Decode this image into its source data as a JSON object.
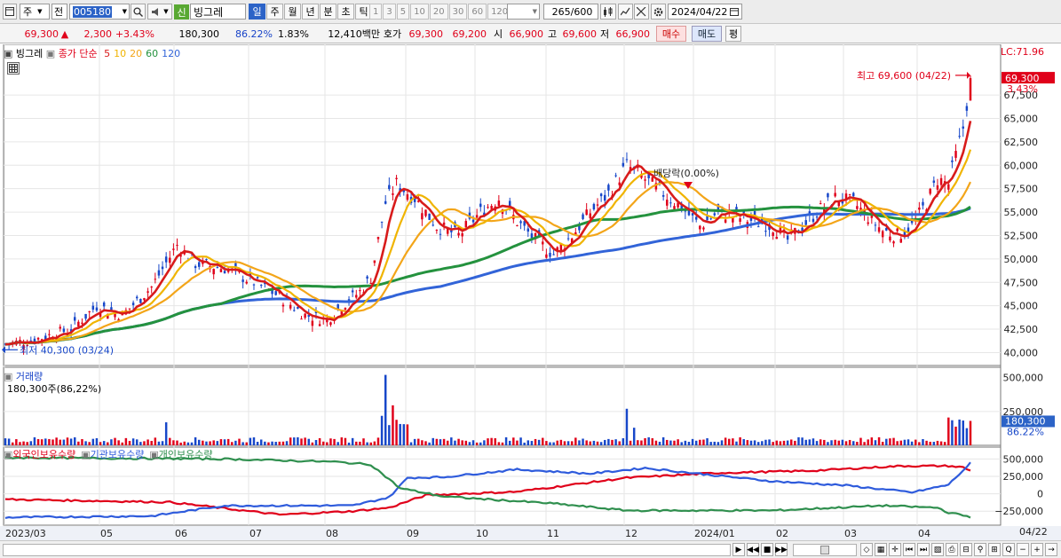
{
  "toolbar": {
    "market_type": "주",
    "market_all": "전",
    "stock_code": "005180",
    "badge_new": "신",
    "stock_name": "빙그레",
    "period_tabs": [
      "일",
      "주",
      "월",
      "년",
      "분",
      "초",
      "틱"
    ],
    "selected_period": "일",
    "interval_numbers": [
      "1",
      "3",
      "5",
      "10",
      "20",
      "30",
      "60",
      "120"
    ],
    "count": "265",
    "count_total": "/600",
    "date": "2024/04/22"
  },
  "quote": {
    "price": "69,300",
    "arrow": "▲",
    "change": "2,300",
    "change_pct": "+3.43%",
    "volume": "180,300",
    "volume_ratio": "86.22%",
    "turnover": "1.83%",
    "trade_value": "12,410백만",
    "hoga_label": "호가",
    "ask": "69,300",
    "bid": "69,200",
    "open_label": "시",
    "open": "66,900",
    "high_label": "고",
    "high": "69,600",
    "low_label": "저",
    "low": "66,900",
    "buy_button": "매수",
    "sell_button": "매도",
    "eval_button": "평"
  },
  "price_pane": {
    "stock_name": "빙그레",
    "legend_prefix": "종가 단순",
    "ma_labels": [
      "5",
      "10",
      "20",
      "60",
      "120"
    ],
    "ma_colors": [
      "#d81b1b",
      "#f0b400",
      "#f3a519",
      "#24923e",
      "#3264d8"
    ],
    "max_annotation": "최고 69,600 (04/22)",
    "min_annotation": "최저 40,300 (03/24)",
    "dividend_annotation": "배당락(0.00%)",
    "lc_label": "LC:71.96",
    "current_price_tag": "69,300",
    "pct_tag": "3.43%",
    "y_ticks": [
      "67,500",
      "65,000",
      "62,500",
      "60,000",
      "57,500",
      "55,000",
      "52,500",
      "50,000",
      "47,500",
      "45,000",
      "42,500",
      "40,000"
    ]
  },
  "volume_pane": {
    "title": "거래량",
    "subtitle": "180,300주(86,22%)",
    "y_ticks": [
      "500,000",
      "250,000"
    ],
    "value_tag": "180,300",
    "pct_tag": "86.22%"
  },
  "holding_pane": {
    "titles": [
      "외국인보유수량",
      "기관보유수량",
      "개인보유수량"
    ],
    "colors": [
      "#e0001a",
      "#2e5bdc",
      "#2f8f4e"
    ],
    "y_ticks": [
      "500,000",
      "250,000",
      "0",
      "−250,000"
    ]
  },
  "x_axis": [
    "2023/03",
    "05",
    "06",
    "07",
    "08",
    "09",
    "10",
    "11",
    "12",
    "2024/01",
    "02",
    "03",
    "04"
  ],
  "x_axis_right": "04/22",
  "chart_data": {
    "type": "candlestick",
    "title": "빙그레",
    "price_range": [
      39000,
      71960
    ],
    "key_points": [
      {
        "date": "2023/03/24",
        "low": 40300
      },
      {
        "date": "2023/05",
        "price": 52000
      },
      {
        "date": "2023/07",
        "price": 44000
      },
      {
        "date": "2023/08",
        "price": 58500
      },
      {
        "date": "2023/10",
        "price": 49500
      },
      {
        "date": "2023/11",
        "price": 60000
      },
      {
        "date": "2024/01",
        "price": 52500
      },
      {
        "date": "2024/02",
        "price": 57500
      },
      {
        "date": "2024/03",
        "price": 52500
      },
      {
        "date": "2024/04/22",
        "close": 69300,
        "high": 69600,
        "open": 66900,
        "low": 66900
      }
    ],
    "moving_averages": [
      {
        "name": "5",
        "color": "#d81b1b"
      },
      {
        "name": "10",
        "color": "#f0b400"
      },
      {
        "name": "20",
        "color": "#f3a519"
      },
      {
        "name": "60",
        "color": "#24923e"
      },
      {
        "name": "120",
        "color": "#3264d8"
      }
    ],
    "volume_last": 180300,
    "volume_range": [
      0,
      550000
    ]
  }
}
